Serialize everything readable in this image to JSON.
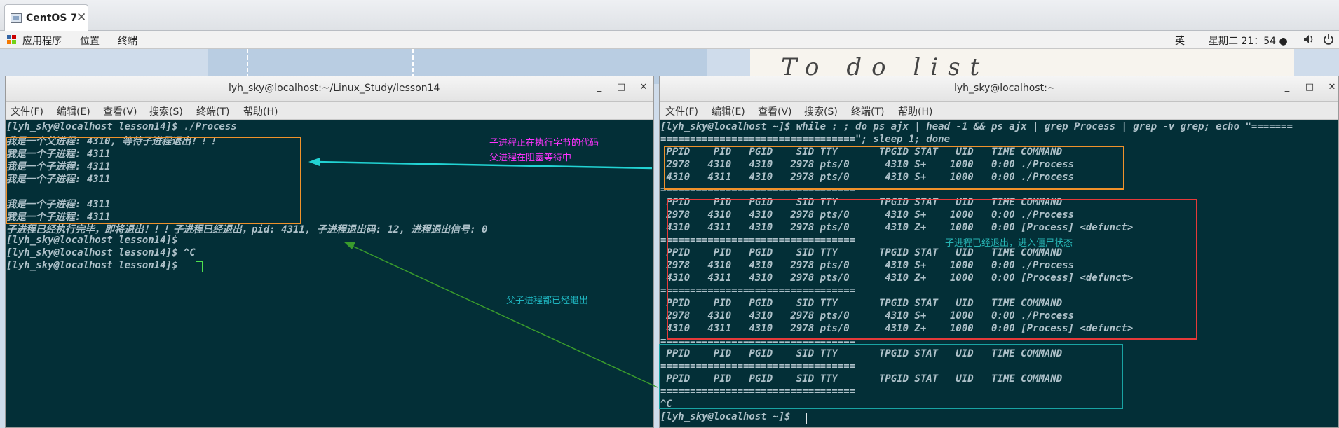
{
  "vm_tab": {
    "title": "CentOS 7",
    "close": "✕"
  },
  "panel": {
    "applications": "应用程序",
    "places": "位置",
    "terminal": "终端",
    "input_method": "英",
    "datetime": "星期二 21：54 ●",
    "volume_icon": "speaker-icon",
    "power_icon": "power-icon",
    "apps_icon_colors": [
      "#3465a4",
      "#cc0000",
      "#f57900",
      "#73d216"
    ]
  },
  "desktop": {
    "handwriting": "To do list"
  },
  "window_left": {
    "title": "lyh_sky@localhost:~/Linux_Study/lesson14",
    "minimize": "_",
    "maximize": "□",
    "close": "✕",
    "menu": [
      "文件(F)",
      "编辑(E)",
      "查看(V)",
      "搜索(S)",
      "终端(T)",
      "帮助(H)"
    ],
    "lines": [
      "[lyh_sky@localhost lesson14]$ ./Process",
      "我是一个父进程: 4310, 等待子进程退出！！！",
      "我是一个子进程: 4311",
      "我是一个子进程: 4311",
      "我是一个子进程: 4311",
      "",
      "我是一个子进程: 4311",
      "我是一个子进程: 4311",
      "子进程已经执行完毕，即将退出！！！子进程已经退出，pid: 4311, 子进程退出码: 12, 进程退出信号: 0",
      "[lyh_sky@localhost lesson14]$",
      "[lyh_sky@localhost lesson14]$ ^C",
      "[lyh_sky@localhost lesson14]$ "
    ]
  },
  "window_right": {
    "title": "lyh_sky@localhost:~",
    "minimize": "_",
    "maximize": "□",
    "close": "✕",
    "menu": [
      "文件(F)",
      "编辑(E)",
      "查看(V)",
      "搜索(S)",
      "终端(T)",
      "帮助(H)"
    ],
    "lines": [
      "[lyh_sky@localhost ~]$ while : ; do ps ajx | head -1 && ps ajx | grep Process | grep -v grep; echo \"=======",
      "=================================\"; sleep 1; done",
      " PPID    PID   PGID    SID TTY       TPGID STAT   UID   TIME COMMAND",
      " 2978   4310   4310   2978 pts/0      4310 S+    1000   0:00 ./Process",
      " 4310   4311   4310   2978 pts/0      4310 S+    1000   0:00 ./Process",
      "=================================",
      " PPID    PID   PGID    SID TTY       TPGID STAT   UID   TIME COMMAND",
      " 2978   4310   4310   2978 pts/0      4310 S+    1000   0:00 ./Process",
      " 4310   4311   4310   2978 pts/0      4310 Z+    1000   0:00 [Process] <defunct>",
      "=================================",
      " PPID    PID   PGID    SID TTY       TPGID STAT   UID   TIME COMMAND",
      " 2978   4310   4310   2978 pts/0      4310 S+    1000   0:00 ./Process",
      " 4310   4311   4310   2978 pts/0      4310 Z+    1000   0:00 [Process] <defunct>",
      "=================================",
      " PPID    PID   PGID    SID TTY       TPGID STAT   UID   TIME COMMAND",
      " 2978   4310   4310   2978 pts/0      4310 S+    1000   0:00 ./Process",
      " 4310   4311   4310   2978 pts/0      4310 Z+    1000   0:00 [Process] <defunct>",
      "=================================",
      " PPID    PID   PGID    SID TTY       TPGID STAT   UID   TIME COMMAND",
      "=================================",
      " PPID    PID   PGID    SID TTY       TPGID STAT   UID   TIME COMMAND",
      "=================================",
      "^C",
      "[lyh_sky@localhost ~]$ "
    ]
  },
  "annotations": {
    "child_running_1": "子进程正在执行字节的代码",
    "child_running_2": "父进程在阻塞等待中",
    "zombie": "子进程已经退出，进入僵尸状态",
    "both_exited": "父子进程都已经退出"
  },
  "colors": {
    "terminal_bg": "#032f37",
    "terminal_text": "#aec1c9",
    "orange_box": "#f0922b",
    "red_box": "#e53a3a",
    "teal_box": "#19a3a3",
    "magenta_text": "#ff33ff",
    "cyan_arrow": "#22d3d3",
    "green_arrow": "#3a9c2c",
    "zombie_text": "#27b5b5",
    "exited_text": "#1fb6c0"
  }
}
